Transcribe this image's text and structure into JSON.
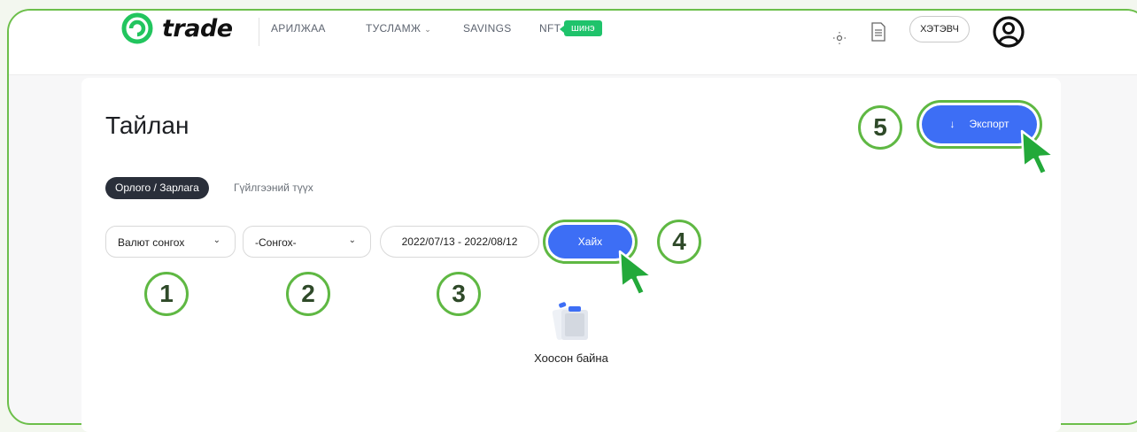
{
  "header": {
    "brand": "trade",
    "nav": [
      {
        "label": "АРИЛЖАА"
      },
      {
        "label": "ТУСЛАМЖ"
      },
      {
        "label": "SAVINGS"
      },
      {
        "label": "NFT"
      }
    ],
    "new_badge": "шинэ",
    "guest_label": "ХЭТЭВЧ",
    "icons": [
      "theme-toggle-icon",
      "document-icon",
      "user-avatar-icon"
    ]
  },
  "page": {
    "title": "Тайлан",
    "tabs": [
      {
        "label": "Орлого / Зарлага",
        "active": true
      },
      {
        "label": "Гүйлгээний түүх",
        "active": false
      }
    ]
  },
  "filters": {
    "currency_select": "Валют сонгох",
    "type_select": "-Сонгох-",
    "date_range": "2022/07/13 - 2022/08/12",
    "search_button": "Хайх"
  },
  "export": {
    "label": "Экспорт",
    "arrow": "↓"
  },
  "empty_state": {
    "text": "Хоосон байна"
  },
  "step_markers": [
    "1",
    "2",
    "3",
    "4",
    "5"
  ],
  "colors": {
    "accent_blue": "#3d6ef5",
    "highlight_green": "#5fb843",
    "badge_green": "#1fc36b"
  }
}
